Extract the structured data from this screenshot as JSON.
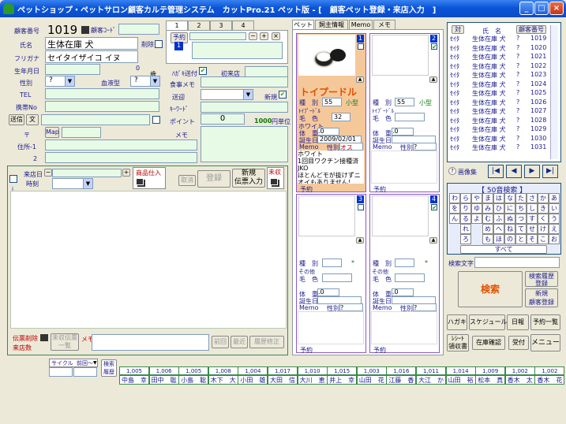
{
  "window": {
    "title": "ペットショップ・ペットサロン顧客カルテ管理システム　カットPro.21 ペット版 - [　顧客ペット登録・来店入力　]",
    "min": "_",
    "max": "□",
    "close": "×"
  },
  "customer": {
    "no_label": "顧客番号",
    "no_value": "1019",
    "code_label": "顧客ｺｰﾄﾞ",
    "name_label": "氏名",
    "name_value": "生体在庫 犬",
    "delete_label": "削除",
    "furi_label": "フリガナ",
    "furi_value": "セイタイザイコ イヌ",
    "birth_label": "生年月日",
    "age_value": "0",
    "age_unit": "歳",
    "sex_label": "性別",
    "sex_value": "?",
    "blood_label": "血液型",
    "blood_value": "?",
    "tel_label": "TEL",
    "mobile_label": "携帯No",
    "send_label": "送信",
    "text_label": "文",
    "zip_label": "〒",
    "map_label": "Map",
    "addr1_label": "住所-1",
    "addr2_label": "2",
    "dm_label": "ﾊｶﾞｷ送付",
    "first_visit_label": "初来店",
    "food_label": "食事メモ",
    "ship_label": "送迎",
    "new_label": "新規",
    "keyword_label": "ｷｰﾜｰﾄﾞ",
    "point_label": "ポイント",
    "point_value": "0",
    "point_unit_value": "1000",
    "point_unit_label": "円単位",
    "memo_label": "メモ"
  },
  "top_tabs": [
    "1",
    "2",
    "3",
    "4"
  ],
  "reserve_label": "予約",
  "visit": {
    "date_label": "来店日",
    "time_label": "時刻",
    "goods_label": "商品仕入",
    "cancel_label": "取消",
    "register_label": "登録",
    "new_slip_label": "新規\n伝票入力",
    "unpaid_label": "未収",
    "slip_delete_label": "伝票削除",
    "visit_count_label": "来店数",
    "unpaid_list_label": "未収伝票\n一覧",
    "memo_label": "メモ",
    "prev_label": "前回",
    "latest_label": "最近",
    "history_edit_label": "履歴修正"
  },
  "pet_tabs": [
    "ペット",
    "飼主情報",
    "Memo",
    "メモ"
  ],
  "pets": [
    {
      "num": "1",
      "breed": "トイプードル",
      "kind_label": "種　別",
      "kind_value": "55",
      "size": "小型",
      "sub_breed": "ﾄｲﾌﾟｰﾄﾞﾙ",
      "color_label": "毛　色",
      "color_value": "32",
      "color_name": "ホワイト",
      "weight_label": "体　重",
      "weight_value": ".0",
      "birth_label": "誕生日",
      "birth_value": "2009/02/01",
      "memo_label": "Memo",
      "sex_label": "性別",
      "sex_value": "オス",
      "memo_text": "ホワイト\n1回目ワクチン接種済\nJKO\nほとんどモが抜けずニオイもありません！",
      "reserve_label": "予約"
    },
    {
      "num": "2",
      "kind_label": "種　別",
      "kind_value": "55",
      "size": "小型",
      "sub_breed": "ﾄｲﾌﾟｰﾄﾞﾙ",
      "color_label": "毛　色",
      "weight_label": "体　重",
      "weight_value": ".0",
      "birth_label": "誕生日",
      "memo_label": "Memo",
      "sex_label": "性別",
      "sex_value": "?",
      "reserve_label": "予約"
    },
    {
      "num": "3",
      "kind_label": "種　別",
      "size": "*",
      "sub_breed": "その他",
      "color_label": "毛　色",
      "weight_label": "体　重",
      "weight_value": ".0",
      "birth_label": "誕生日",
      "memo_label": "Memo",
      "sex_label": "性別",
      "sex_value": "?",
      "reserve_label": "予約"
    },
    {
      "num": "4",
      "kind_label": "種　別",
      "size": "*",
      "sub_breed": "その他",
      "color_label": "毛　色",
      "weight_label": "体　重",
      "weight_value": ".0",
      "birth_label": "誕生日",
      "memo_label": "Memo",
      "sex_label": "性別",
      "sex_value": "?",
      "reserve_label": "予約"
    }
  ],
  "list": {
    "col_pair": "対",
    "col_name": "氏　名",
    "col_no": "顧客番号",
    "rows": [
      {
        "kana": "ｾｲﾀ",
        "name": "生体在庫 犬",
        "q": "?",
        "no": "1019"
      },
      {
        "kana": "ｾｲﾀ",
        "name": "生体在庫 犬",
        "q": "?",
        "no": "1020"
      },
      {
        "kana": "ｾｲﾀ",
        "name": "生体在庫 犬",
        "q": "?",
        "no": "1021"
      },
      {
        "kana": "ｾｲﾀ",
        "name": "生体在庫 犬",
        "q": "?",
        "no": "1022"
      },
      {
        "kana": "ｾｲﾀ",
        "name": "生体在庫 犬",
        "q": "?",
        "no": "1023"
      },
      {
        "kana": "ｾｲﾀ",
        "name": "生体在庫 犬",
        "q": "?",
        "no": "1024"
      },
      {
        "kana": "ｾｲﾀ",
        "name": "生体在庫 犬",
        "q": "?",
        "no": "1025"
      },
      {
        "kana": "ｾｲﾀ",
        "name": "生体在庫 犬",
        "q": "?",
        "no": "1026"
      },
      {
        "kana": "ｾｲﾀ",
        "name": "生体在庫 犬",
        "q": "?",
        "no": "1027"
      },
      {
        "kana": "ｾｲﾀ",
        "name": "生体在庫 犬",
        "q": "?",
        "no": "1028"
      },
      {
        "kana": "ｾｲﾀ",
        "name": "生体在庫 犬",
        "q": "?",
        "no": "1029"
      },
      {
        "kana": "ｾｲﾀ",
        "name": "生体在庫 犬",
        "q": "?",
        "no": "1030"
      },
      {
        "kana": "ｾｲﾀ",
        "name": "生体在庫 犬",
        "q": "?",
        "no": "1031"
      }
    ]
  },
  "nav": {
    "image_list": "画像集",
    "first": "|◀",
    "prev": "◀",
    "next": "▶",
    "last": "▶|"
  },
  "kana": {
    "title": "【 50音検索 】",
    "keys": [
      "わ",
      "ら",
      "や",
      "ま",
      "は",
      "な",
      "た",
      "さ",
      "か",
      "あ",
      "を",
      "り",
      "ゆ",
      "み",
      "ひ",
      "に",
      "ち",
      "し",
      "き",
      "い",
      "ん",
      "る",
      "よ",
      "む",
      "ふ",
      "ぬ",
      "つ",
      "す",
      "く",
      "う",
      "",
      "れ",
      "",
      "め",
      "へ",
      "ね",
      "て",
      "せ",
      "け",
      "え",
      "",
      "ろ",
      "",
      "も",
      "ほ",
      "の",
      "と",
      "そ",
      "こ",
      "お"
    ],
    "all": "すべて"
  },
  "search": {
    "label": "検索文字",
    "button": "検索",
    "history": "検索履歴\n登録",
    "new_customer": "新規\n顧客登録"
  },
  "bottom": {
    "postcard": "ハガキ",
    "schedule": "スケジュール",
    "daily": "日報",
    "reserve_list": "予約一覧",
    "receipt": "ﾚｼｰﾄ\n領収書",
    "stock": "在庫確認",
    "reception": "受付",
    "menu": "メニュー"
  },
  "history_bar": {
    "cycle": "サイクル",
    "prev": "前回～",
    "search_hist": "検索\n履歴",
    "items": [
      {
        "no": "1,005",
        "name": "中島　幸"
      },
      {
        "no": "1,006",
        "name": "田中　聡"
      },
      {
        "no": "1,005",
        "name": "小島　聡"
      },
      {
        "no": "1,008",
        "name": "木下　大"
      },
      {
        "no": "1,004",
        "name": "小田　雄"
      },
      {
        "no": "1,017",
        "name": "大田　信"
      },
      {
        "no": "1,010",
        "name": "大川　恵"
      },
      {
        "no": "1,015",
        "name": "井上　幸"
      },
      {
        "no": "1,003",
        "name": "山田　花"
      },
      {
        "no": "1,016",
        "name": "江藤　香"
      },
      {
        "no": "1,011",
        "name": "大江　か"
      },
      {
        "no": "1,014",
        "name": "山田　裕"
      },
      {
        "no": "1,009",
        "name": "松本　真"
      },
      {
        "no": "1,002",
        "name": "香木　太"
      },
      {
        "no": "1,002",
        "name": "香木　花"
      }
    ]
  }
}
